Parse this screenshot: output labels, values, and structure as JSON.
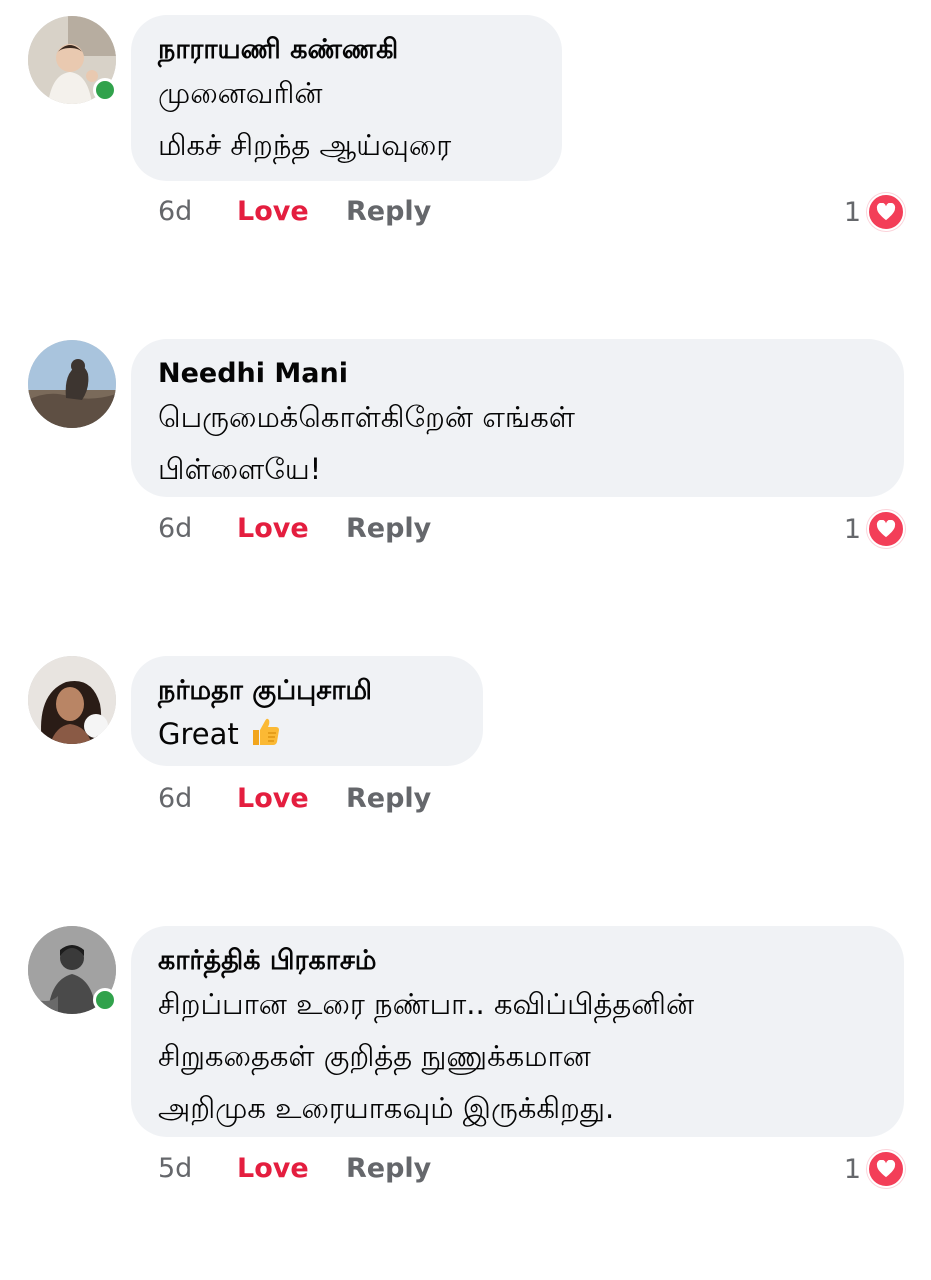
{
  "comments": [
    {
      "author": "நாராயணி கண்ணகி",
      "text": "முனைவரின்\nமிகச் சிறந்த ஆய்வுரை",
      "time": "6d",
      "love_label": "Love",
      "reply_label": "Reply",
      "reaction_count": "1",
      "online": true
    },
    {
      "author": "Needhi Mani",
      "text": "பெருமைக்கொள்கிறேன் எங்கள்\nபிள்ளையே!",
      "time": "6d",
      "love_label": "Love",
      "reply_label": "Reply",
      "reaction_count": "1",
      "online": false
    },
    {
      "author": "நர்மதா குப்புசாமி",
      "text": "Great",
      "emoji": "thumbs-up-icon",
      "time": "6d",
      "love_label": "Love",
      "reply_label": "Reply",
      "reaction_count": "",
      "online": false
    },
    {
      "author": "கார்த்திக் பிரகாசம்",
      "text": "சிறப்பான உரை நண்பா.. கவிப்பித்தனின்\nசிறுகதைகள் குறித்த நுணுக்கமான\nஅறிமுக உரையாகவும் இருக்கிறது.",
      "time": "5d",
      "love_label": "Love",
      "reply_label": "Reply",
      "reaction_count": "1",
      "online": true
    }
  ],
  "colors": {
    "bubble": "#f0f2f5",
    "love": "#e41e3f",
    "muted": "#65676b",
    "online": "#31a24c",
    "heart": "#f33e58"
  }
}
